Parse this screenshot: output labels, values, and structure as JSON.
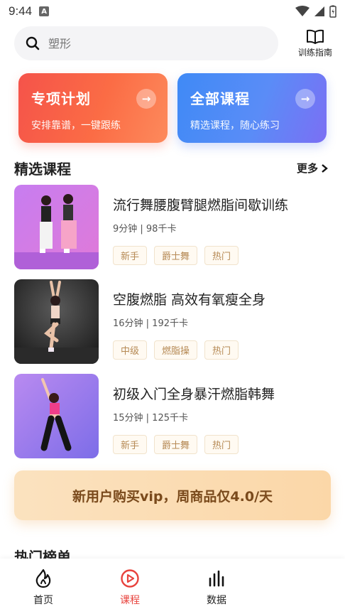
{
  "status": {
    "time": "9:44"
  },
  "search": {
    "placeholder": "塑形"
  },
  "guide": {
    "label": "训练指南"
  },
  "cards": [
    {
      "title": "专项计划",
      "subtitle": "安排靠谱，一键跟练"
    },
    {
      "title": "全部课程",
      "subtitle": "精选课程，随心练习"
    }
  ],
  "section": {
    "title": "精选课程",
    "more": "更多"
  },
  "courses": [
    {
      "name": "流行舞腰腹臂腿燃脂间歇训练",
      "meta": "9分钟 | 98千卡",
      "tags": [
        "新手",
        "爵士舞",
        "热门"
      ]
    },
    {
      "name": "空腹燃脂 高效有氧瘦全身",
      "meta": "16分钟 | 192千卡",
      "tags": [
        "中级",
        "燃脂操",
        "热门"
      ]
    },
    {
      "name": "初级入门全身暴汗燃脂韩舞",
      "meta": "15分钟 | 125千卡",
      "tags": [
        "新手",
        "爵士舞",
        "热门"
      ]
    }
  ],
  "banner": {
    "text": "新用户购买vip，周商品仅4.0/天"
  },
  "hot": {
    "title": "热门榜单"
  },
  "tabs": [
    {
      "label": "首页",
      "icon": "flame-icon"
    },
    {
      "label": "课程",
      "icon": "play-circle-icon"
    },
    {
      "label": "数据",
      "icon": "bar-chart-icon"
    }
  ],
  "colors": {
    "accent": "#e8433d",
    "tag_text": "#b68a55"
  }
}
